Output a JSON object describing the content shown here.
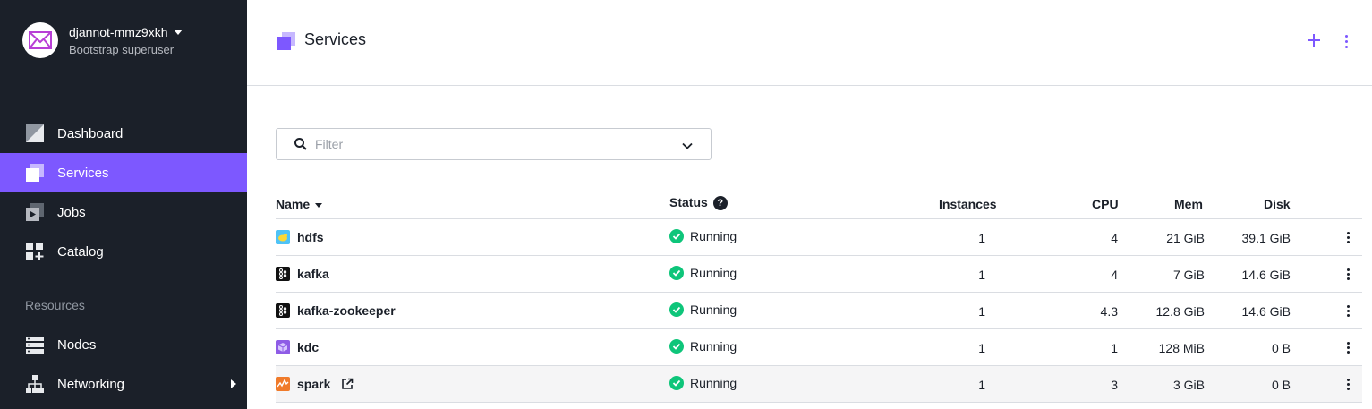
{
  "sidebar": {
    "cluster_name": "djannot-mmz9xkh",
    "cluster_role": "Bootstrap superuser",
    "items": [
      {
        "label": "Dashboard",
        "icon": "dashboard-icon"
      },
      {
        "label": "Services",
        "icon": "services-icon",
        "active": true
      },
      {
        "label": "Jobs",
        "icon": "jobs-icon"
      },
      {
        "label": "Catalog",
        "icon": "catalog-icon"
      }
    ],
    "section_label": "Resources",
    "resource_items": [
      {
        "label": "Nodes",
        "icon": "nodes-icon"
      },
      {
        "label": "Networking",
        "icon": "networking-icon"
      }
    ]
  },
  "header": {
    "title": "Services",
    "add_icon": "plus-icon",
    "more_icon": "more-vertical-icon"
  },
  "filter": {
    "placeholder": "Filter"
  },
  "table": {
    "columns": {
      "name": "Name",
      "status": "Status",
      "instances": "Instances",
      "cpu": "CPU",
      "mem": "Mem",
      "disk": "Disk"
    },
    "rows": [
      {
        "name": "hdfs",
        "status": "Running",
        "instances": "1",
        "cpu": "4",
        "mem": "21 GiB",
        "disk": "39.1 GiB",
        "icon": "hdfs-icon"
      },
      {
        "name": "kafka",
        "status": "Running",
        "instances": "1",
        "cpu": "4",
        "mem": "7 GiB",
        "disk": "14.6 GiB",
        "icon": "kafka-icon"
      },
      {
        "name": "kafka-zookeeper",
        "status": "Running",
        "instances": "1",
        "cpu": "4.3",
        "mem": "12.8 GiB",
        "disk": "14.6 GiB",
        "icon": "kafka-icon"
      },
      {
        "name": "kdc",
        "status": "Running",
        "instances": "1",
        "cpu": "1",
        "mem": "128 MiB",
        "disk": "0 B",
        "icon": "kdc-icon"
      },
      {
        "name": "spark",
        "status": "Running",
        "instances": "1",
        "cpu": "3",
        "mem": "3 GiB",
        "disk": "0 B",
        "icon": "spark-icon"
      }
    ]
  },
  "colors": {
    "sidebar_bg": "#1b2029",
    "accent": "#7d58ff",
    "running": "#0ec57a"
  }
}
